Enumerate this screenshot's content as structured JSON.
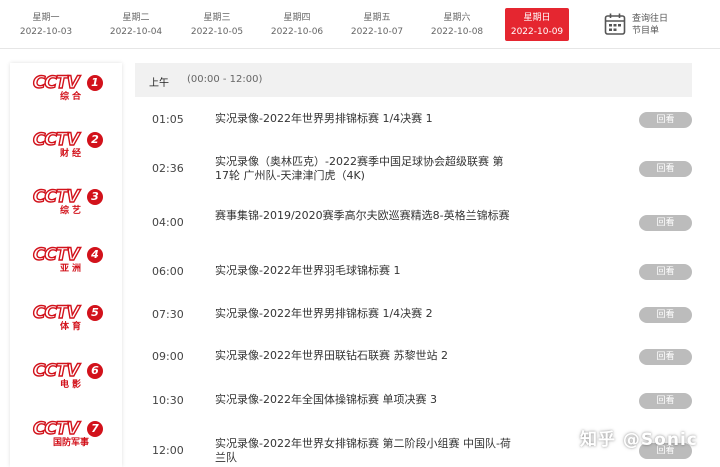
{
  "dates": [
    {
      "weekday": "星期一",
      "date": "2022-10-03",
      "active": false
    },
    {
      "weekday": "星期二",
      "date": "2022-10-04",
      "active": false
    },
    {
      "weekday": "星期三",
      "date": "2022-10-05",
      "active": false
    },
    {
      "weekday": "星期四",
      "date": "2022-10-06",
      "active": false
    },
    {
      "weekday": "星期五",
      "date": "2022-10-07",
      "active": false
    },
    {
      "weekday": "星期六",
      "date": "2022-10-08",
      "active": false
    },
    {
      "weekday": "星期日",
      "date": "2022-10-09",
      "active": true
    }
  ],
  "calendar": {
    "line1": "查询往日",
    "line2": "节目单",
    "icon": "calendar-icon"
  },
  "channels": [
    {
      "brand": "CCTV",
      "num": "1",
      "name": "综合"
    },
    {
      "brand": "CCTV",
      "num": "2",
      "name": "财经"
    },
    {
      "brand": "CCTV",
      "num": "3",
      "name": "综艺"
    },
    {
      "brand": "CCTV",
      "num": "4",
      "name": "亚洲"
    },
    {
      "brand": "CCTV",
      "num": "5",
      "name": "体育"
    },
    {
      "brand": "CCTV",
      "num": "6",
      "name": "电影"
    },
    {
      "brand": "CCTV",
      "num": "7",
      "name": "国防军事"
    }
  ],
  "period": {
    "name": "上午",
    "range": "(00:00 - 12:00)"
  },
  "programs": [
    {
      "time": "01:05",
      "title": "实况录像-2022年世界男排锦标赛 1/4决赛 1",
      "action": "回看"
    },
    {
      "time": "02:36",
      "title": "实况录像（奥林匹克）-2022赛季中国足球协会超级联赛 第17轮 广州队-天津津门虎（4K)",
      "action": "回看"
    },
    {
      "time": "04:00",
      "title": "赛事集锦-2019/2020赛季高尔夫欧巡赛精选8-英格兰锦标赛",
      "action": "回看"
    },
    {
      "time": "06:00",
      "title": "实况录像-2022年世界羽毛球锦标赛 1",
      "action": "回看"
    },
    {
      "time": "07:30",
      "title": "实况录像-2022年世界男排锦标赛 1/4决赛 2",
      "action": "回看"
    },
    {
      "time": "09:00",
      "title": "实况录像-2022年世界田联钻石联赛 苏黎世站 2",
      "action": "回看"
    },
    {
      "time": "10:30",
      "title": "实况录像-2022年全国体操锦标赛 单项决赛 3",
      "action": "回看"
    },
    {
      "time": "12:00",
      "title": "实况录像-2022年世界女排锦标赛 第二阶段小组赛 中国队-荷兰队",
      "action": "回看"
    }
  ],
  "watermark": "知乎 @Sonic",
  "colors": {
    "accent": "#e52630",
    "brand_red": "#d2121b",
    "button_gray": "#bcbcbc",
    "period_bg": "#f1f1f1"
  }
}
